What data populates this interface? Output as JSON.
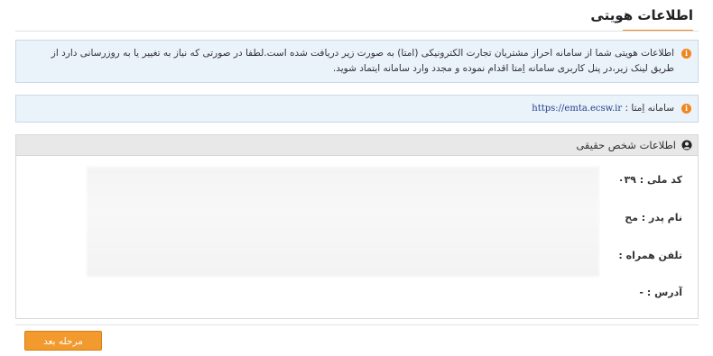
{
  "page": {
    "title": "اطلاعات هویتی"
  },
  "notice": {
    "icon": "info-icon",
    "text": "اطلاعات هویتی شما از سامانه احراز مشتریان تجارت الکترونیکی (امتا) به صورت زیر دریافت شده است.لطفا در صورتی که نیاز به تغییر یا به روزرسانی دارد از طریق لینک زیر،در پنل کاربری سامانه اِمتا اقدام نموده و مجدد وارد سامانه ایتماد شوید."
  },
  "emta": {
    "icon": "info-icon",
    "label": "سامانه اِمتا :",
    "link": "https://emta.ecsw.ir"
  },
  "panel": {
    "icon": "user-circle-icon",
    "title": "اطلاعات شخص حقیقی",
    "fields": [
      {
        "label": "کد ملی :",
        "value": "۰۳۹"
      },
      {
        "label": "نام پدر :",
        "value": "مح"
      },
      {
        "label": "تلفن همراه :",
        "value": ""
      },
      {
        "label": "آدرس :",
        "value": "-"
      }
    ]
  },
  "actions": {
    "next_label": "مرحله بعد"
  },
  "colors": {
    "accent": "#f0861e",
    "info_bg": "#eaf2fa",
    "info_border": "#c9d9e8",
    "panel_header_bg": "#e8e8e8",
    "link": "#1f3d8a"
  }
}
